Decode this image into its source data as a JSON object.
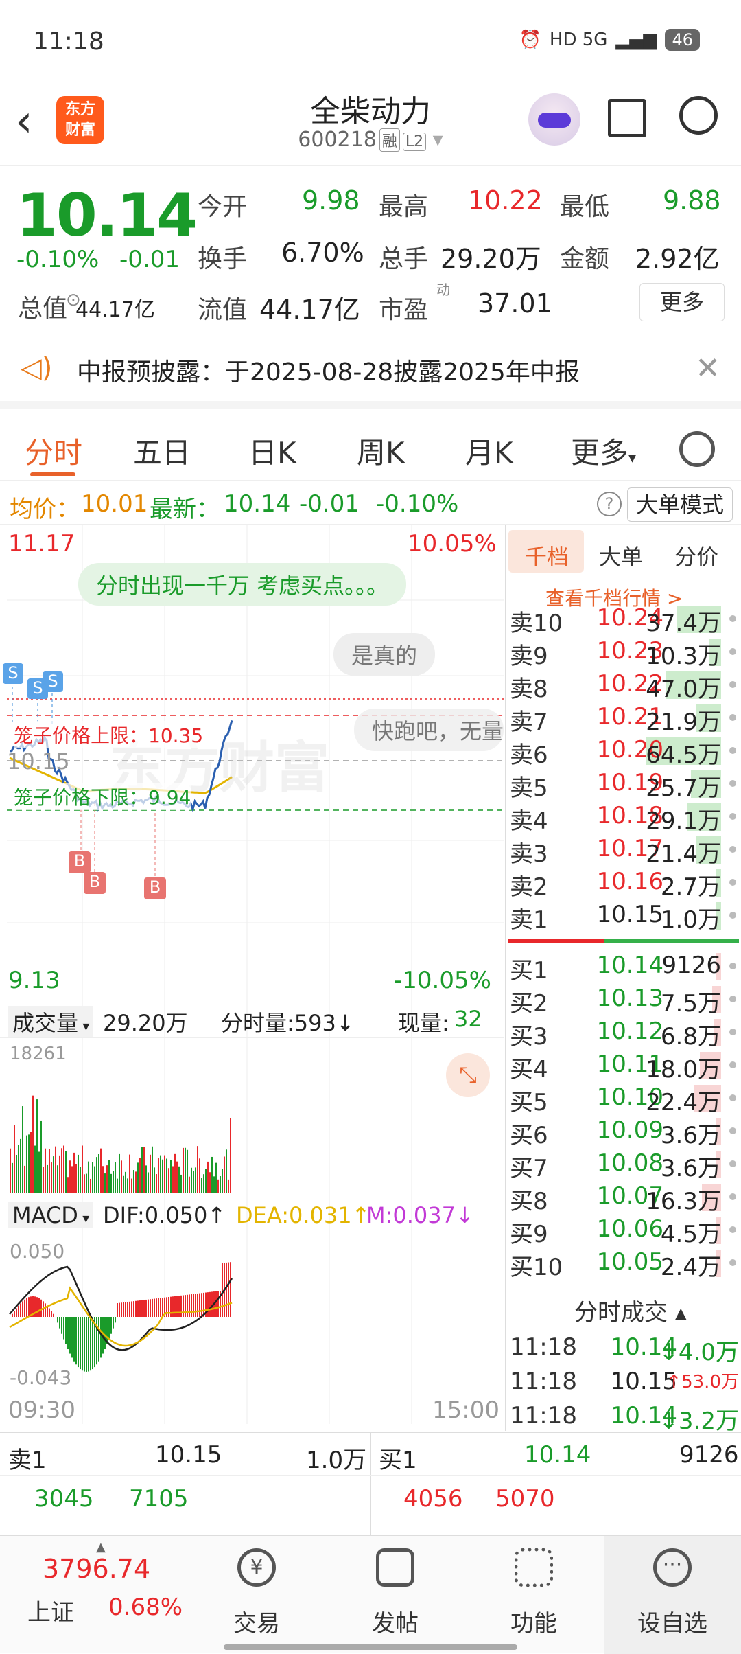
{
  "status_bar": {
    "time": "11:18",
    "net": "HD 5G",
    "battery": "46"
  },
  "header": {
    "logo_line1": "东方",
    "logo_line2": "财富",
    "title": "全柴动力",
    "code": "600218",
    "tag_rong": "融",
    "tag_l2": "L2"
  },
  "quote": {
    "price": "10.14",
    "change_pct": "-0.10%",
    "change": "-0.01",
    "open_label": "今开",
    "open": "9.98",
    "high_label": "最高",
    "high": "10.22",
    "low_label": "最低",
    "low": "9.88",
    "turnover_label": "换手",
    "turnover": "6.70%",
    "volume_label": "总手",
    "volume": "29.20万",
    "amount_label": "金额",
    "amount": "2.92亿",
    "mcap_label": "总值",
    "mcap": "44.17亿",
    "float_label": "流值",
    "float": "44.17亿",
    "pe_label": "市盈",
    "pe_sup": "动",
    "pe": "37.01",
    "more": "更多"
  },
  "notice": {
    "text": "中报预披露：于2025-08-28披露2025年中报"
  },
  "tabs": [
    "分时",
    "五日",
    "日K",
    "周K",
    "月K",
    "更多"
  ],
  "avg_line": {
    "avg_label": "均价：",
    "avg": "10.01",
    "latest_label": "最新：",
    "latest": "10.14",
    "chg": "-0.01",
    "pct": "-0.10%",
    "big_mode": "大单模式"
  },
  "chart": {
    "y_top": "11.17",
    "y_top_pct": "10.05%",
    "y_bot": "9.13",
    "y_bot_pct": "-10.05%",
    "mid_label": "10.15",
    "bubble1": "分时出现一千万 考虑买点。。。",
    "bubble2": "是真的",
    "bubble3": "快跑吧，无量",
    "upper_limit": "笼子价格上限：10.35",
    "lower_limit": "笼子价格下限：9.94",
    "watermark": "东方财富",
    "vol_label": "成交量",
    "vol_total": "29.20万",
    "vol_tick_label": "分时量:593↓",
    "vol_now_label": "现量:",
    "vol_now": "32",
    "vol_max": "18261",
    "macd_label": "MACD",
    "dif": "DIF:0.050↑",
    "dea": "DEA:0.031↑",
    "m": "M:0.037↓",
    "macd_top": "0.050",
    "macd_bot": "-0.043",
    "time_start": "09:30",
    "time_end": "15:00",
    "colors": {
      "up": "#e8282b",
      "down": "#1a9b2a",
      "line": "#2a5fb0",
      "avg": "#e3b400"
    }
  },
  "depth": {
    "tabs": [
      "千档",
      "大单",
      "分价"
    ],
    "link": "查看千档行情 >",
    "sell": [
      {
        "l": "卖10",
        "p": "10.24",
        "v": "37.4万",
        "w": 0.58
      },
      {
        "l": "卖9",
        "p": "10.23",
        "v": "10.3万",
        "w": 0.16
      },
      {
        "l": "卖8",
        "p": "10.22",
        "v": "47.0万",
        "w": 0.73
      },
      {
        "l": "卖7",
        "p": "10.21",
        "v": "21.9万",
        "w": 0.34
      },
      {
        "l": "卖6",
        "p": "10.20",
        "v": "64.5万",
        "w": 1.0
      },
      {
        "l": "卖5",
        "p": "10.19",
        "v": "25.7万",
        "w": 0.4
      },
      {
        "l": "卖4",
        "p": "10.18",
        "v": "29.1万",
        "w": 0.45
      },
      {
        "l": "卖3",
        "p": "10.17",
        "v": "21.4万",
        "w": 0.33
      },
      {
        "l": "卖2",
        "p": "10.16",
        "v": "2.7万",
        "w": 0.04
      },
      {
        "l": "卖1",
        "p": "10.15",
        "v": "1.0万",
        "w": 0.02
      }
    ],
    "buy": [
      {
        "l": "买1",
        "p": "10.14",
        "v": "9126",
        "w": 0.02
      },
      {
        "l": "买2",
        "p": "10.13",
        "v": "7.5万",
        "w": 0.12
      },
      {
        "l": "买3",
        "p": "10.12",
        "v": "6.8万",
        "w": 0.1
      },
      {
        "l": "买4",
        "p": "10.11",
        "v": "18.0万",
        "w": 0.28
      },
      {
        "l": "买5",
        "p": "10.10",
        "v": "22.4万",
        "w": 0.35
      },
      {
        "l": "买6",
        "p": "10.09",
        "v": "3.6万",
        "w": 0.06
      },
      {
        "l": "买7",
        "p": "10.08",
        "v": "3.6万",
        "w": 0.06
      },
      {
        "l": "买8",
        "p": "10.07",
        "v": "16.3万",
        "w": 0.25
      },
      {
        "l": "买9",
        "p": "10.06",
        "v": "4.5万",
        "w": 0.07
      },
      {
        "l": "买10",
        "p": "10.05",
        "v": "2.4万",
        "w": 0.04
      }
    ],
    "trades_title": "分时成交",
    "trades": [
      {
        "t": "11:18",
        "p": "10.14",
        "v": "↓4.0万",
        "c": "green"
      },
      {
        "t": "11:18",
        "p": "10.15",
        "v": "↑53.0万",
        "c": "red"
      },
      {
        "t": "11:18",
        "p": "10.14",
        "v": "↓3.2万",
        "c": "green"
      }
    ]
  },
  "orders": {
    "sell_label": "卖1",
    "sell_price": "10.15",
    "sell_vol": "1.0万",
    "buy_label": "买1",
    "buy_price": "10.14",
    "buy_vol": "9126",
    "left_a": "3045",
    "left_b": "7105",
    "right_a": "4056",
    "right_b": "5070"
  },
  "nav": {
    "index_value": "3796.74",
    "index_name": "上证",
    "index_pct": "0.68%",
    "items": [
      "交易",
      "发帖",
      "功能",
      "设自选"
    ]
  }
}
